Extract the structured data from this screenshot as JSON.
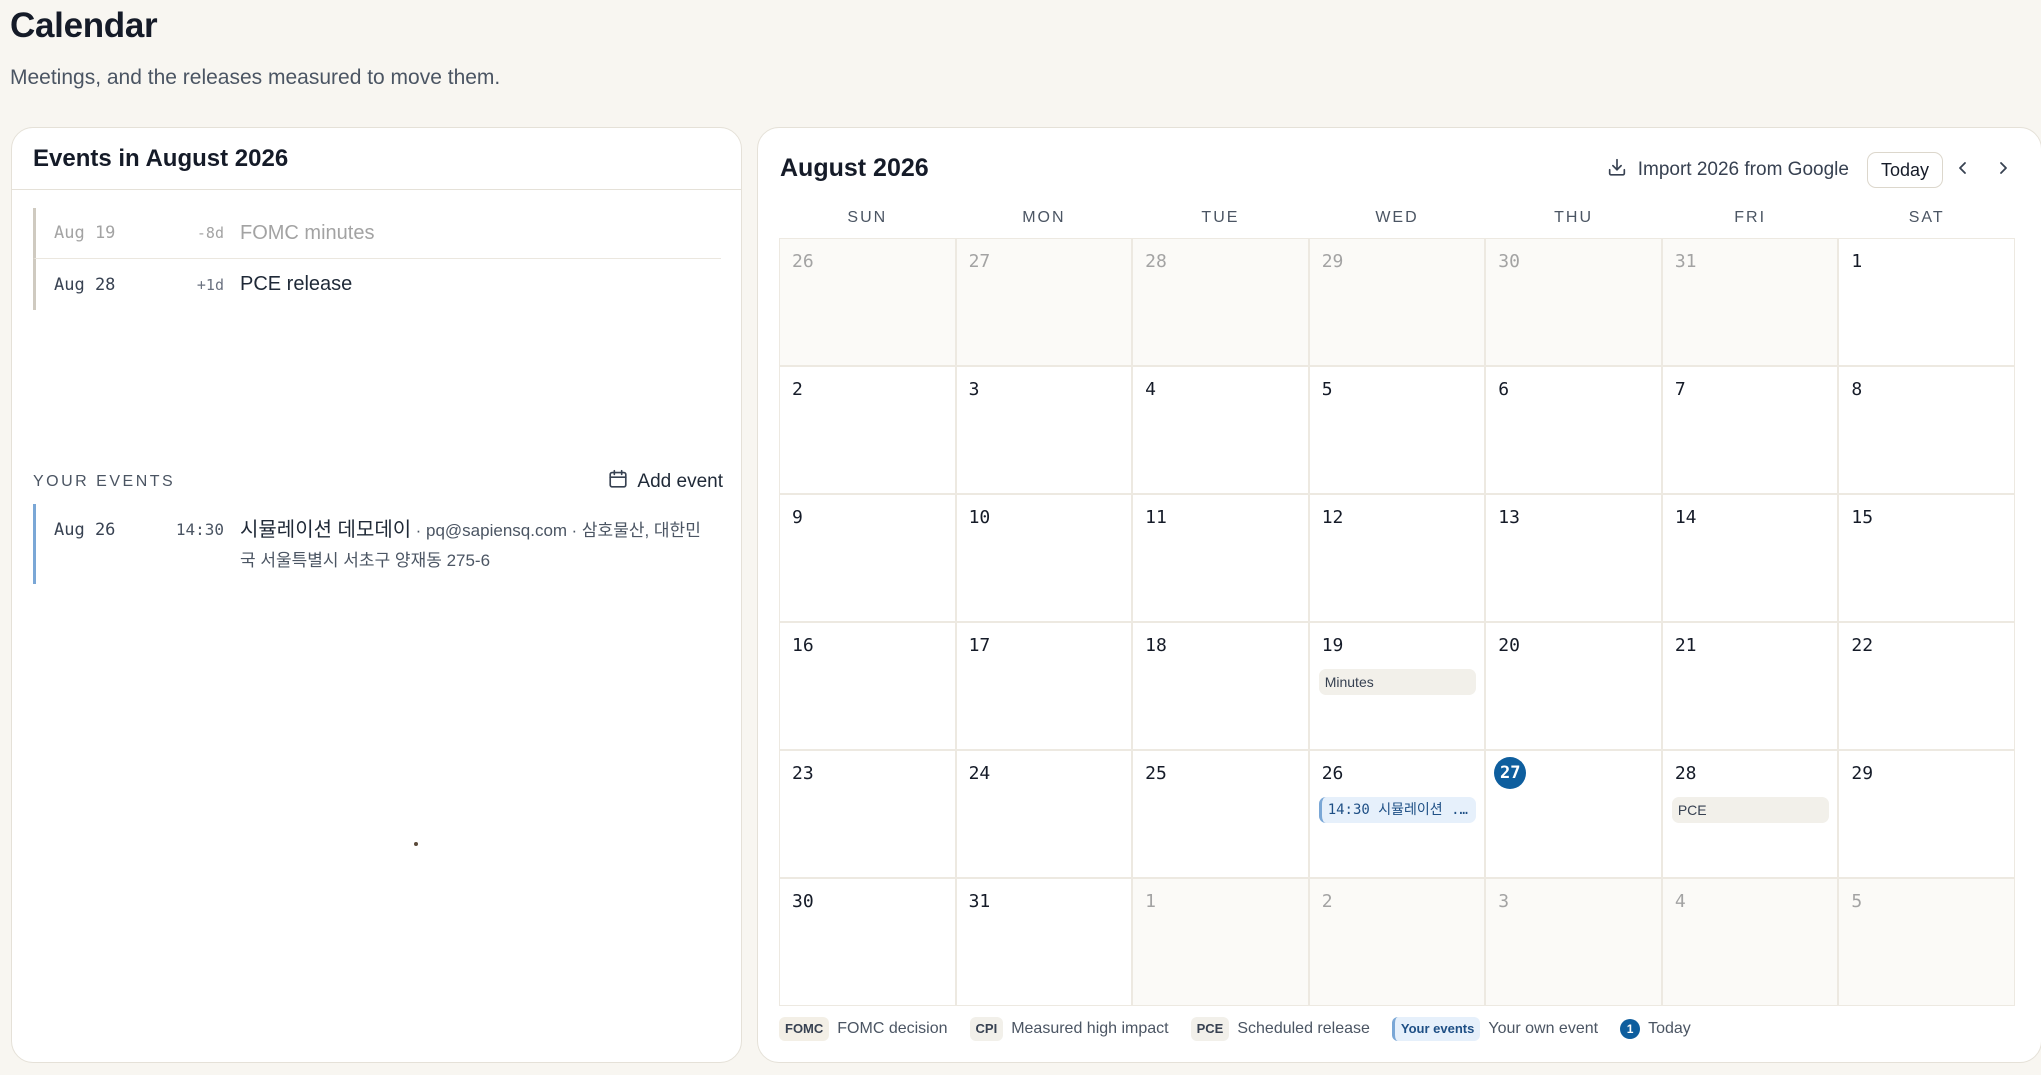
{
  "page": {
    "title": "Calendar",
    "subtitle": "Meetings, and the releases measured to move them."
  },
  "left": {
    "header": "Events in August 2026",
    "events": [
      {
        "date": "Aug 19",
        "offset": "-8d",
        "name": "FOMC minutes",
        "past": true
      },
      {
        "date": "Aug 28",
        "offset": "+1d",
        "name": "PCE release",
        "past": false
      }
    ],
    "your_events_label": "YOUR EVENTS",
    "add_event_label": "Add event",
    "user_event": {
      "date": "Aug 26",
      "time": "14:30",
      "title": "시뮬레이션 데모데이",
      "email": "· pq@sapiensq.com",
      "location_a": "· 삼호물산, 대한민",
      "location_b": "국 서울특별시 서초구 양재동 275-6"
    }
  },
  "calendar": {
    "month_title": "August 2026",
    "import_label": "Import 2026 from Google",
    "today_label": "Today",
    "weekdays": [
      "SUN",
      "MON",
      "TUE",
      "WED",
      "THU",
      "FRI",
      "SAT"
    ],
    "today_date": "27",
    "chips": {
      "minutes": "Minutes",
      "pce": "PCE",
      "user": "14:30 시뮬레이션 ..."
    },
    "colors": {
      "today": "#0e5e9e",
      "user_accent": "#7aa7d6"
    }
  },
  "legend": {
    "fomc_badge": "FOMC",
    "fomc_label": "FOMC decision",
    "cpi_badge": "CPI",
    "cpi_label": "Measured high impact",
    "pce_badge": "PCE",
    "pce_label": "Scheduled release",
    "user_badge": "Your events",
    "user_label": "Your own event",
    "today_badge": "1",
    "today_label": "Today"
  },
  "icons": {
    "add_event": "calendar-plus-icon",
    "import": "download-icon",
    "prev": "chevron-left-icon",
    "next": "chevron-right-icon"
  }
}
